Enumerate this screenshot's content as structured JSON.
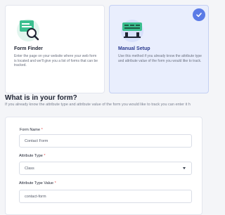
{
  "cards": [
    {
      "title": "Form Finder",
      "description": "Enter the page on your website where your web form is located and we'll give you a list of forms that can be tracked.",
      "icon": "form-search-icon",
      "selected": false
    },
    {
      "title": "Manual Setup",
      "description": "Use this method if you already know the attribute type and attribute value of the form you would like to track.",
      "icon": "manual-setup-icon",
      "selected": true
    }
  ],
  "section": {
    "title": "What is in your form?",
    "subtitle": "If you already know the attribute type and attribute value of the form you would like to track you can enter it h"
  },
  "form": {
    "name_label": "Form Name",
    "name_value": "Contact Form",
    "attr_type_label": "Attribute Type",
    "attr_type_value": "Class",
    "attr_value_label": "Attribute Type Value",
    "attr_value_value": "contact-form",
    "required_mark": "*"
  },
  "colors": {
    "accent": "#5b7be6",
    "selected_card_bg": "#e9eefd",
    "illustration_green": "#3bbf8f"
  }
}
